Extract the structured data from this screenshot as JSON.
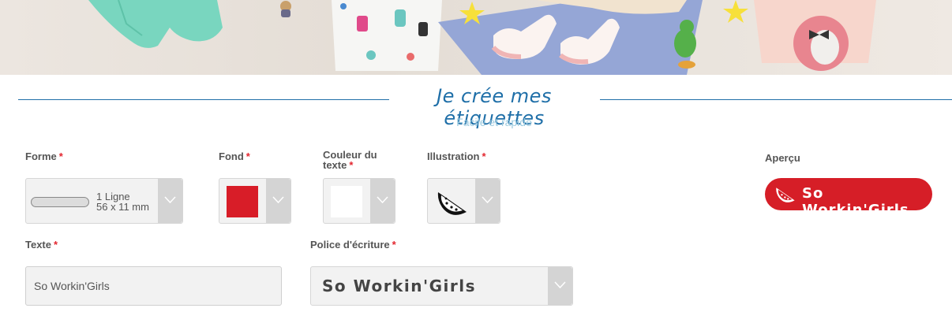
{
  "header": {
    "title": "Je crée mes étiquettes",
    "subtitle": "Facile et rapide"
  },
  "form": {
    "required_mark": "*",
    "forme": {
      "label": "Forme",
      "value_line1": "1 Ligne",
      "value_line2": "56 x 11 mm"
    },
    "fond": {
      "label": "Fond",
      "color": "#d81d28"
    },
    "couleur_texte": {
      "label_line1": "Couleur du",
      "label_line2": "texte",
      "color": "#ffffff"
    },
    "illustration": {
      "label": "Illustration",
      "icon": "watermelon-icon"
    },
    "texte": {
      "label": "Texte",
      "value": "So Workin'Girls"
    },
    "police": {
      "label": "Police d'écriture",
      "value": "So Workin'Girls"
    }
  },
  "preview": {
    "label": "Aperçu",
    "text": "So Workin'Girls",
    "background": "#d61e27",
    "icon": "watermelon-icon"
  },
  "colors": {
    "accent_blue": "#1f6fa8",
    "subtitle_blue": "#9ccbe0",
    "required_red": "#e3262f"
  }
}
